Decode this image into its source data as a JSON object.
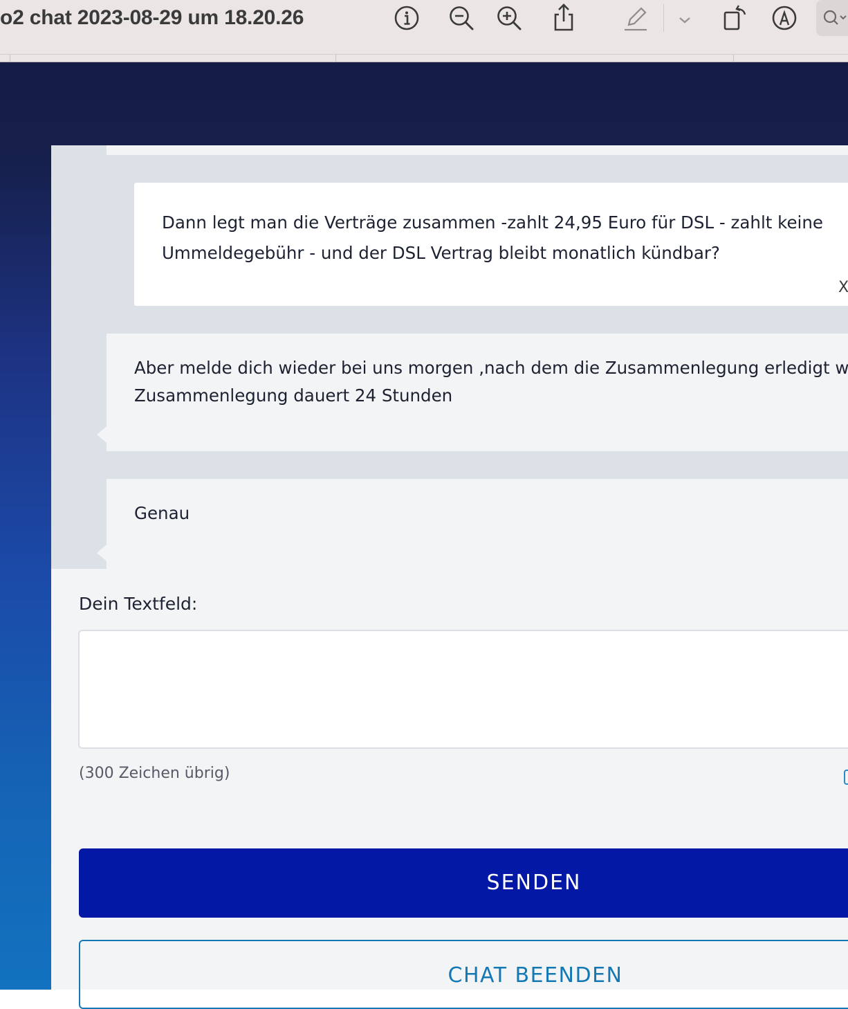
{
  "window": {
    "title": "o2 chat 2023-08-29 um 18.20.26",
    "icons": [
      "info-icon",
      "zoom-out-icon",
      "zoom-in-icon",
      "share-icon",
      "markup-pen-icon",
      "chevron-down-icon",
      "rotate-icon",
      "annotate-icon",
      "search-icon"
    ]
  },
  "chat": {
    "messages": [
      {
        "sender": "user",
        "text": "Dann legt man die Verträge zusammen -zahlt 24,95 Euro für DSL - zahlt keine Ummeldegebühr - und der DSL Vertrag bleibt monatlich kündbar?",
        "close_mark": "X"
      },
      {
        "sender": "agent",
        "line1": "Aber melde dich wieder bei uns morgen ,nach dem die Zusammenlegung erledigt wi",
        "line2": "Zusammenlegung dauert 24 Stunden"
      },
      {
        "sender": "agent",
        "text": "Genau"
      }
    ]
  },
  "form": {
    "label": "Dein Textfeld:",
    "value": "",
    "remaining": "(300 Zeichen übrig)",
    "send_label": "SENDEN",
    "end_label": "CHAT BEENDEN"
  },
  "colors": {
    "send_button": "#0318a5",
    "end_button_outline": "#1478b5",
    "page_gradient_top": "#151c45",
    "page_gradient_bottom": "#1272bf"
  }
}
